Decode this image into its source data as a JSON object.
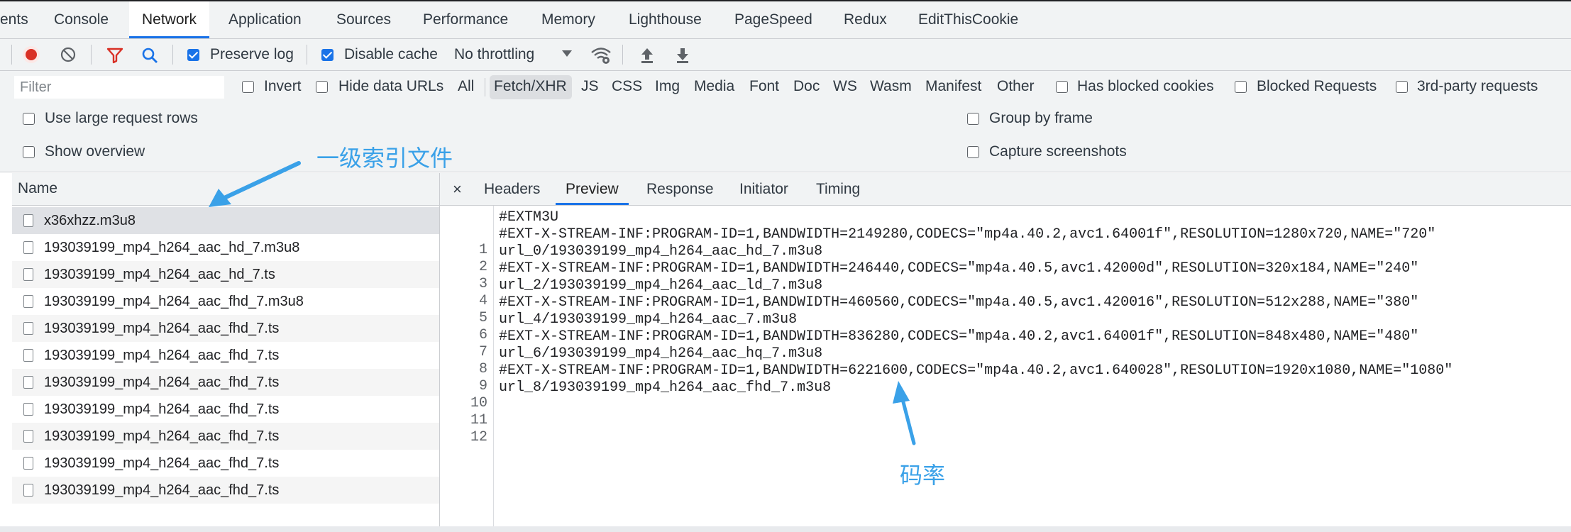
{
  "tabs": [
    "ents",
    "Console",
    "Network",
    "Application",
    "Sources",
    "Performance",
    "Memory",
    "Lighthouse",
    "PageSpeed",
    "Redux",
    "EditThisCookie"
  ],
  "active_tab": "Network",
  "toolbar": {
    "record_icon": "record-icon",
    "clear_icon": "clear-icon",
    "filter_icon": "filter-icon",
    "search_icon": "search-icon",
    "preserve_log": "Preserve log",
    "preserve_log_checked": true,
    "disable_cache": "Disable cache",
    "disable_cache_checked": true,
    "throttling": "No throttling"
  },
  "filterbar": {
    "placeholder": "Filter",
    "invert": "Invert",
    "hide_data_urls": "Hide data URLs",
    "types": [
      "All",
      "Fetch/XHR",
      "JS",
      "CSS",
      "Img",
      "Media",
      "Font",
      "Doc",
      "WS",
      "Wasm",
      "Manifest",
      "Other"
    ],
    "active_type": "Fetch/XHR",
    "has_blocked_cookies": "Has blocked cookies",
    "blocked_requests": "Blocked Requests",
    "third_party": "3rd-party requests"
  },
  "options": {
    "large_rows": "Use large request rows",
    "show_overview": "Show overview",
    "group_by_frame": "Group by frame",
    "capture_screenshots": "Capture screenshots"
  },
  "requests": {
    "header": "Name",
    "rows": [
      "x36xhzz.m3u8",
      "193039199_mp4_h264_aac_hd_7.m3u8",
      "193039199_mp4_h264_aac_hd_7.ts",
      "193039199_mp4_h264_aac_fhd_7.m3u8",
      "193039199_mp4_h264_aac_fhd_7.ts",
      "193039199_mp4_h264_aac_fhd_7.ts",
      "193039199_mp4_h264_aac_fhd_7.ts",
      "193039199_mp4_h264_aac_fhd_7.ts",
      "193039199_mp4_h264_aac_fhd_7.ts",
      "193039199_mp4_h264_aac_fhd_7.ts",
      "193039199_mp4_h264_aac_fhd_7.ts"
    ]
  },
  "detail": {
    "close": "×",
    "tabs": [
      "Headers",
      "Preview",
      "Response",
      "Initiator",
      "Timing"
    ],
    "active_tab": "Preview",
    "lines": [
      "#EXTM3U",
      "#EXT-X-STREAM-INF:PROGRAM-ID=1,BANDWIDTH=2149280,CODECS=\"mp4a.40.2,avc1.64001f\",RESOLUTION=1280x720,NAME=\"720\"",
      "url_0/193039199_mp4_h264_aac_hd_7.m3u8",
      "#EXT-X-STREAM-INF:PROGRAM-ID=1,BANDWIDTH=246440,CODECS=\"mp4a.40.5,avc1.42000d\",RESOLUTION=320x184,NAME=\"240\"",
      "url_2/193039199_mp4_h264_aac_ld_7.m3u8",
      "#EXT-X-STREAM-INF:PROGRAM-ID=1,BANDWIDTH=460560,CODECS=\"mp4a.40.5,avc1.420016\",RESOLUTION=512x288,NAME=\"380\"",
      "url_4/193039199_mp4_h264_aac_7.m3u8",
      "#EXT-X-STREAM-INF:PROGRAM-ID=1,BANDWIDTH=836280,CODECS=\"mp4a.40.2,avc1.64001f\",RESOLUTION=848x480,NAME=\"480\"",
      "url_6/193039199_mp4_h264_aac_hq_7.m3u8",
      "#EXT-X-STREAM-INF:PROGRAM-ID=1,BANDWIDTH=6221600,CODECS=\"mp4a.40.2,avc1.640028\",RESOLUTION=1920x1080,NAME=\"1080\"",
      "url_8/193039199_mp4_h264_aac_fhd_7.m3u8",
      ""
    ]
  },
  "annotations": {
    "index_file": "一级索引文件",
    "bitrate": "码率",
    "color": "#3aa1e8"
  }
}
